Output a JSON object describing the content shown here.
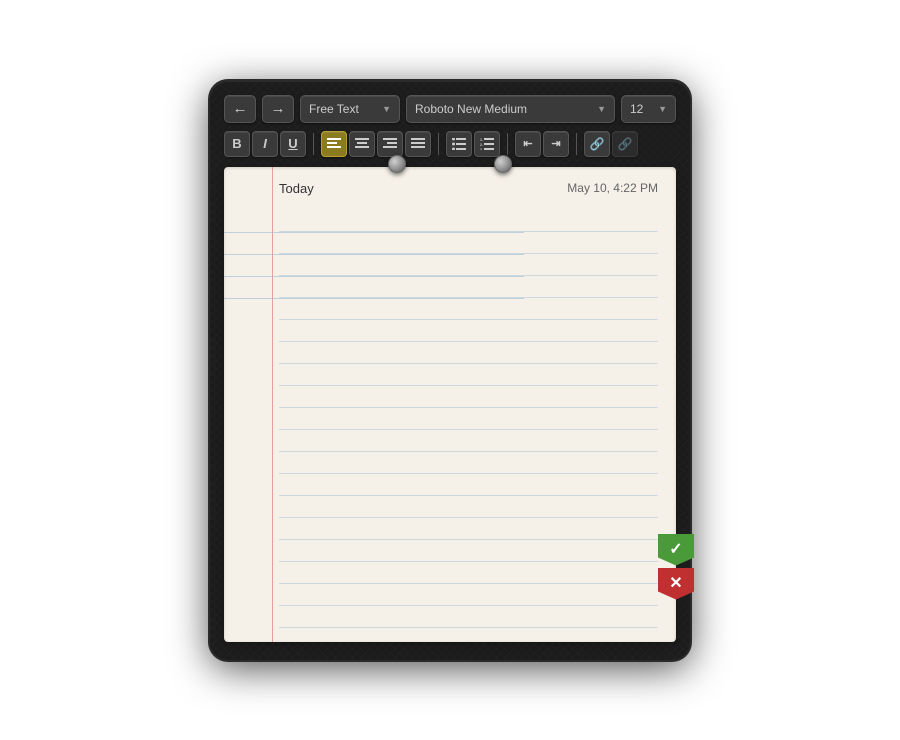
{
  "toolbar": {
    "undo_label": "←",
    "redo_label": "→",
    "freetype_label": "Free Text",
    "freetype_chevron": "▼",
    "font_label": "Roboto New Medium",
    "font_chevron": "▼",
    "size_label": "12",
    "size_chevron": "▼",
    "bold_label": "B",
    "italic_label": "I",
    "underline_label": "U",
    "align_left": "≡",
    "align_center": "≡",
    "align_right": "≡",
    "align_justify": "≡",
    "list_bullet": "≡",
    "list_num": "≡",
    "indent_decrease": "←",
    "indent_increase": "→",
    "link_add": "🔗",
    "link_remove": "🔗"
  },
  "note": {
    "date_label": "Today",
    "datetime": "May 10, 4:22 PM"
  },
  "bookmarks": {
    "confirm_icon": "✓",
    "cancel_icon": "✕"
  }
}
